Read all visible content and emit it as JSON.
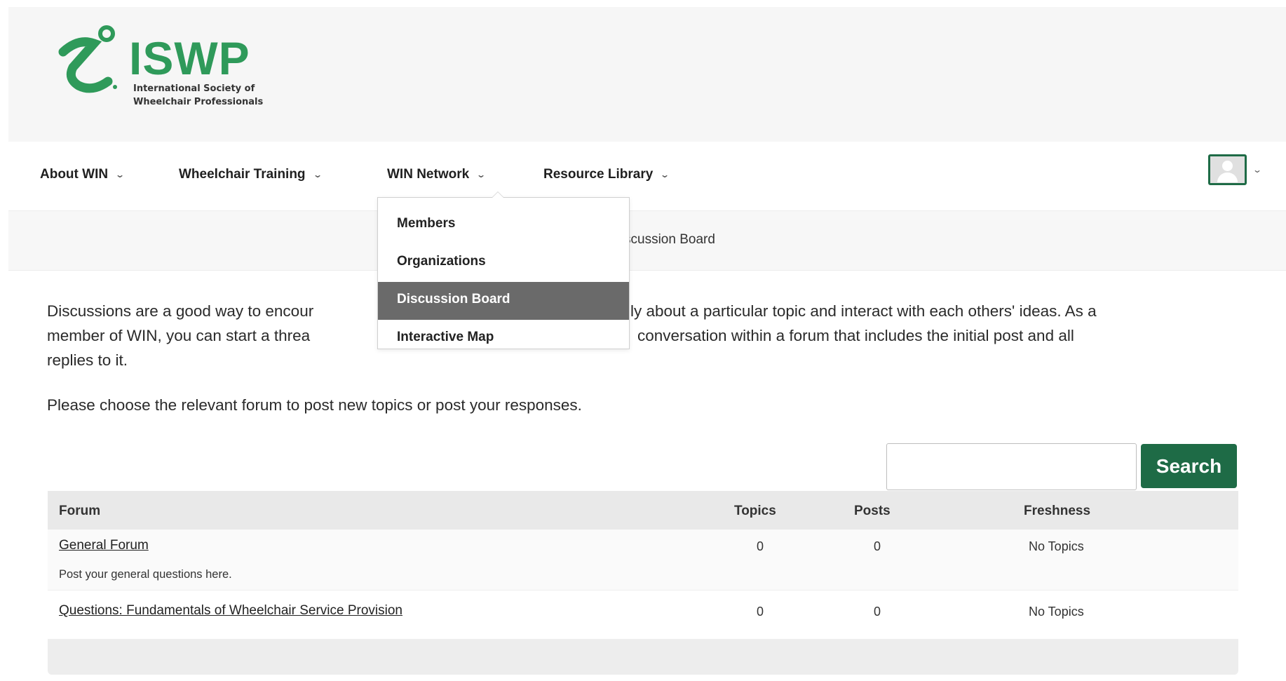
{
  "logo": {
    "wordmark": "ISWP",
    "subtitle_line1": "International Society of",
    "subtitle_line2": "Wheelchair Professionals",
    "brand_color": "#2f9a5a"
  },
  "nav": {
    "items": [
      {
        "label": "About WIN"
      },
      {
        "label": "Wheelchair Training"
      },
      {
        "label": "WIN Network"
      },
      {
        "label": "Resource Library"
      }
    ],
    "chevron_icon": "chevron-down-icon",
    "avatar_icon": "user-avatar-icon"
  },
  "breadcrumb": {
    "visible_text": "scussion Board"
  },
  "dropdown": {
    "items": [
      {
        "label": "Members",
        "active": false
      },
      {
        "label": "Organizations",
        "active": false
      },
      {
        "label": "Discussion Board",
        "active": true
      },
      {
        "label": "Interactive Map",
        "active": false
      }
    ],
    "active_bg": "#6a6a6a"
  },
  "intro": {
    "line1_left": "Discussions are a good way to encour",
    "line1_right": "ly about a particular topic and interact with each others' ideas. As a",
    "line2_left": "member of WIN, you can start a threa",
    "line2_right": "conversation within a forum that includes the initial post and all",
    "line3": "replies to it.",
    "choose": "Please choose the relevant forum to post new topics or post your responses."
  },
  "search": {
    "value": "",
    "placeholder": "",
    "button_label": "Search",
    "button_color": "#1e6b46"
  },
  "table": {
    "headers": {
      "forum": "Forum",
      "topics": "Topics",
      "posts": "Posts",
      "freshness": "Freshness"
    },
    "rows": [
      {
        "title": "General Forum",
        "description": "Post your general questions here.",
        "topics": "0",
        "posts": "0",
        "freshness": "No Topics"
      },
      {
        "title": "Questions: Fundamentals of Wheelchair Service Provision",
        "description": "",
        "topics": "0",
        "posts": "0",
        "freshness": "No Topics"
      }
    ]
  }
}
